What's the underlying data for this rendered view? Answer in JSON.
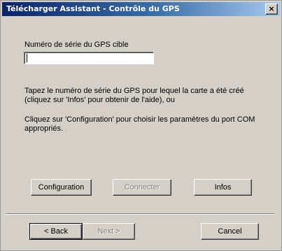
{
  "window": {
    "title": "Télécharger Assistant - Contrôle du GPS",
    "close_glyph": "×"
  },
  "serial": {
    "label": "Numéro de série du GPS cible",
    "value": ""
  },
  "instructions": {
    "line1": "Tapez le numéro de série du GPS pour lequel la carte a été créé",
    "line2": "(cliquez sur 'Infos' pour obtenir de l'aide), ou",
    "line3": "Cliquez sur 'Configuration' pour choisir les paramètres du port COM",
    "line4": "appropriés."
  },
  "actions": {
    "configuration": "Configuration",
    "connect": "Connecter",
    "info": "Infos"
  },
  "nav": {
    "back": "< Back",
    "next": "Next >",
    "cancel": "Cancel"
  }
}
